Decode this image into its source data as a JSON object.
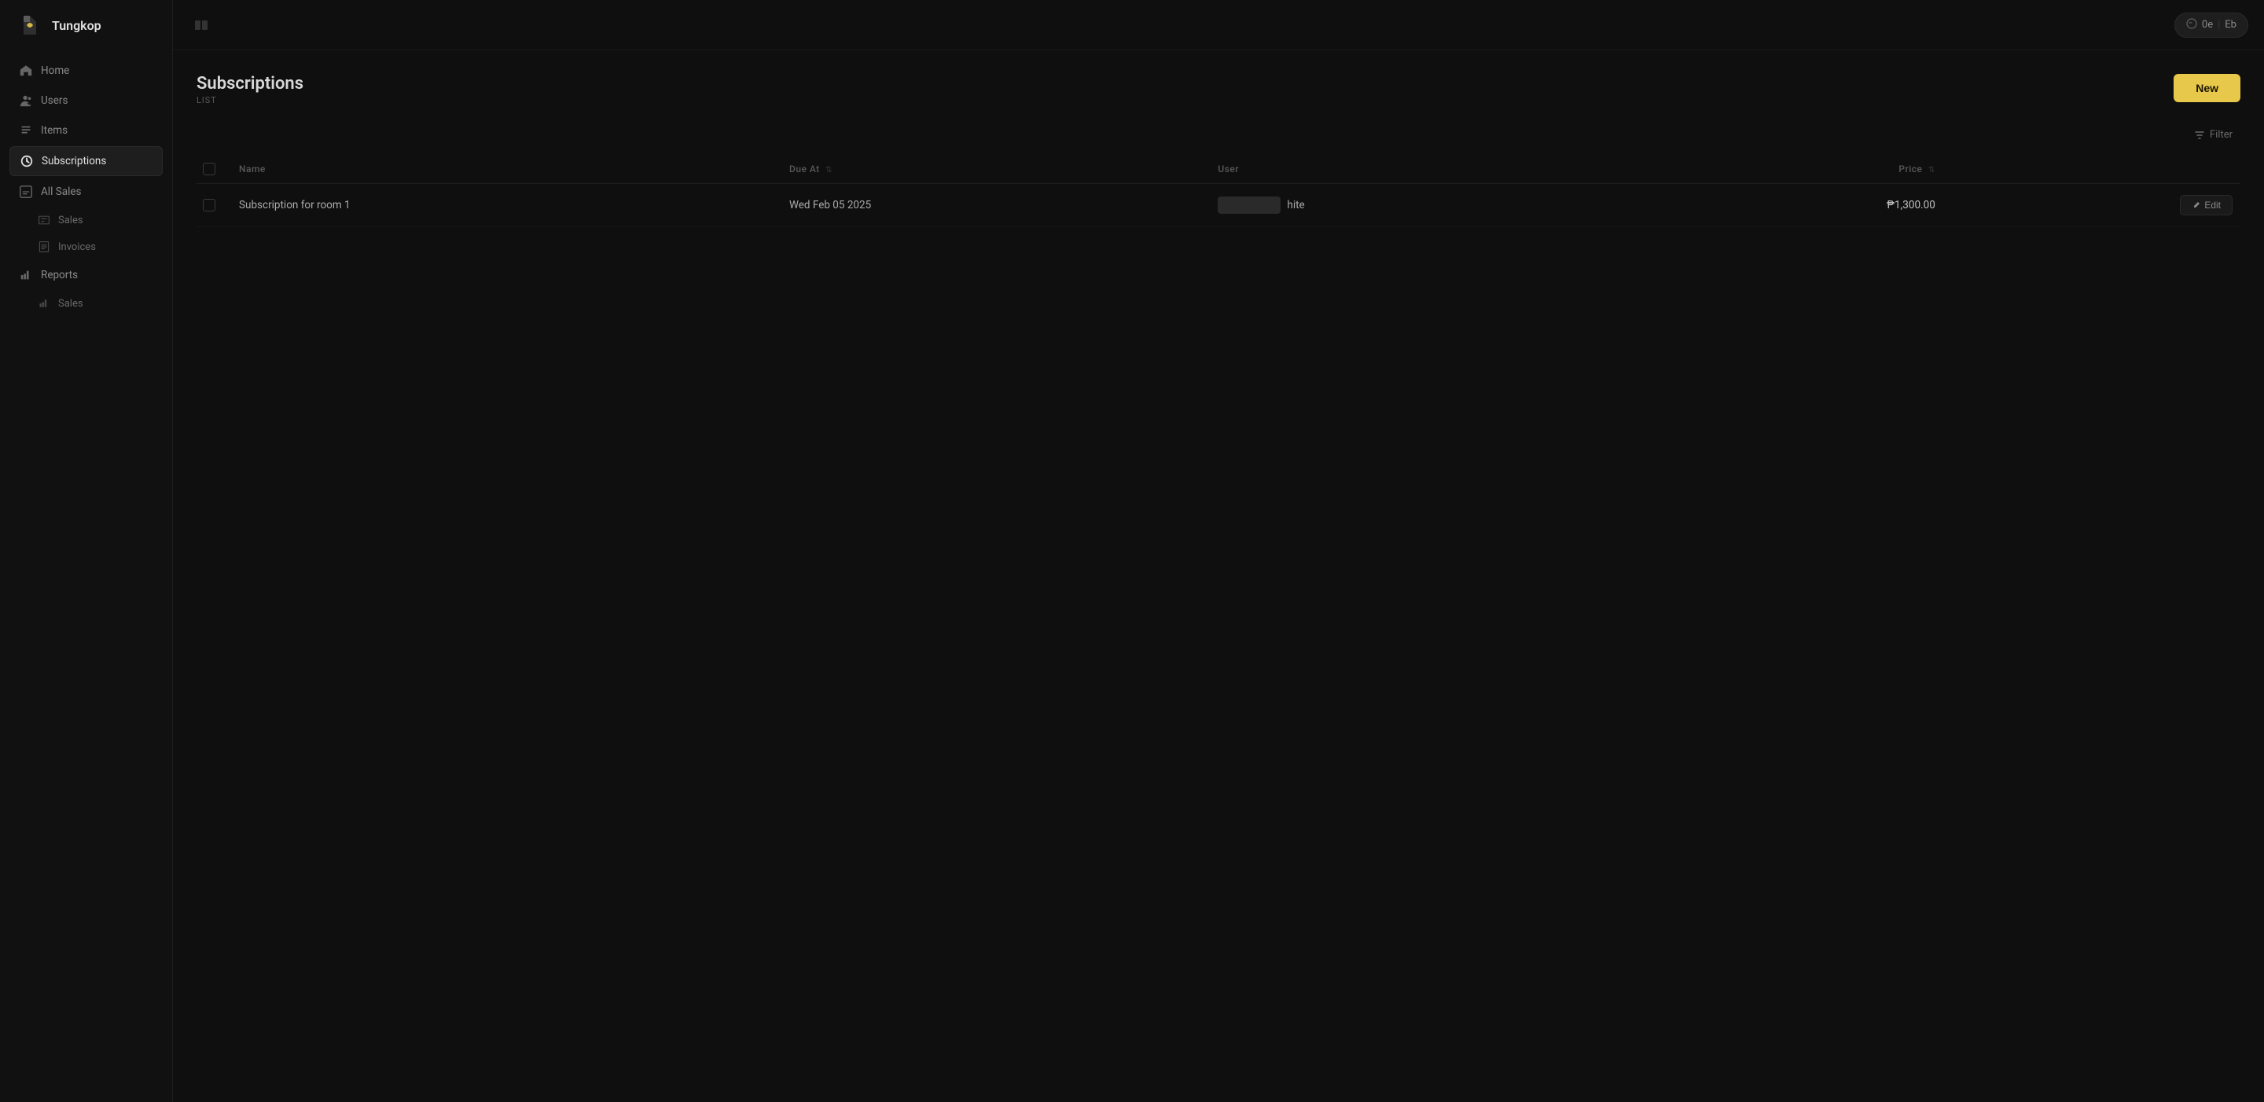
{
  "app": {
    "name": "Tungkop",
    "logo_alt": "Tungkop logo"
  },
  "topbar": {
    "user_badge_label": "0e",
    "user_badge_label2": "Eb"
  },
  "sidebar": {
    "items": [
      {
        "id": "home",
        "label": "Home",
        "icon": "home-icon",
        "active": false,
        "indent": false
      },
      {
        "id": "users",
        "label": "Users",
        "icon": "users-icon",
        "active": false,
        "indent": false
      },
      {
        "id": "items",
        "label": "Items",
        "icon": "items-icon",
        "active": false,
        "indent": false
      },
      {
        "id": "subscriptions",
        "label": "Subscriptions",
        "icon": "subscriptions-icon",
        "active": true,
        "indent": false
      },
      {
        "id": "all-sales",
        "label": "All Sales",
        "icon": "all-sales-icon",
        "active": false,
        "indent": false
      }
    ],
    "sub_items": [
      {
        "id": "sales",
        "label": "Sales",
        "icon": "sales-icon"
      },
      {
        "id": "invoices",
        "label": "Invoices",
        "icon": "invoices-icon"
      }
    ],
    "bottom_items": [
      {
        "id": "reports",
        "label": "Reports",
        "icon": "reports-icon",
        "active": false
      },
      {
        "id": "sales-report",
        "label": "Sales",
        "icon": "sales-report-icon",
        "active": false
      }
    ]
  },
  "page": {
    "title": "Subscriptions",
    "subtitle": "LIST",
    "new_button_label": "New",
    "filter_label": "Filter"
  },
  "table": {
    "columns": [
      {
        "id": "checkbox",
        "label": ""
      },
      {
        "id": "name",
        "label": "Name"
      },
      {
        "id": "due_at",
        "label": "Due At"
      },
      {
        "id": "user",
        "label": "User"
      },
      {
        "id": "price",
        "label": "Price"
      },
      {
        "id": "actions",
        "label": ""
      }
    ],
    "rows": [
      {
        "id": "row1",
        "name": "Subscription for room 1",
        "due_at": "Wed Feb 05 2025",
        "user_blurred": true,
        "user_name": "hite",
        "price": "₱1,300.00",
        "edit_label": "Edit"
      }
    ]
  }
}
